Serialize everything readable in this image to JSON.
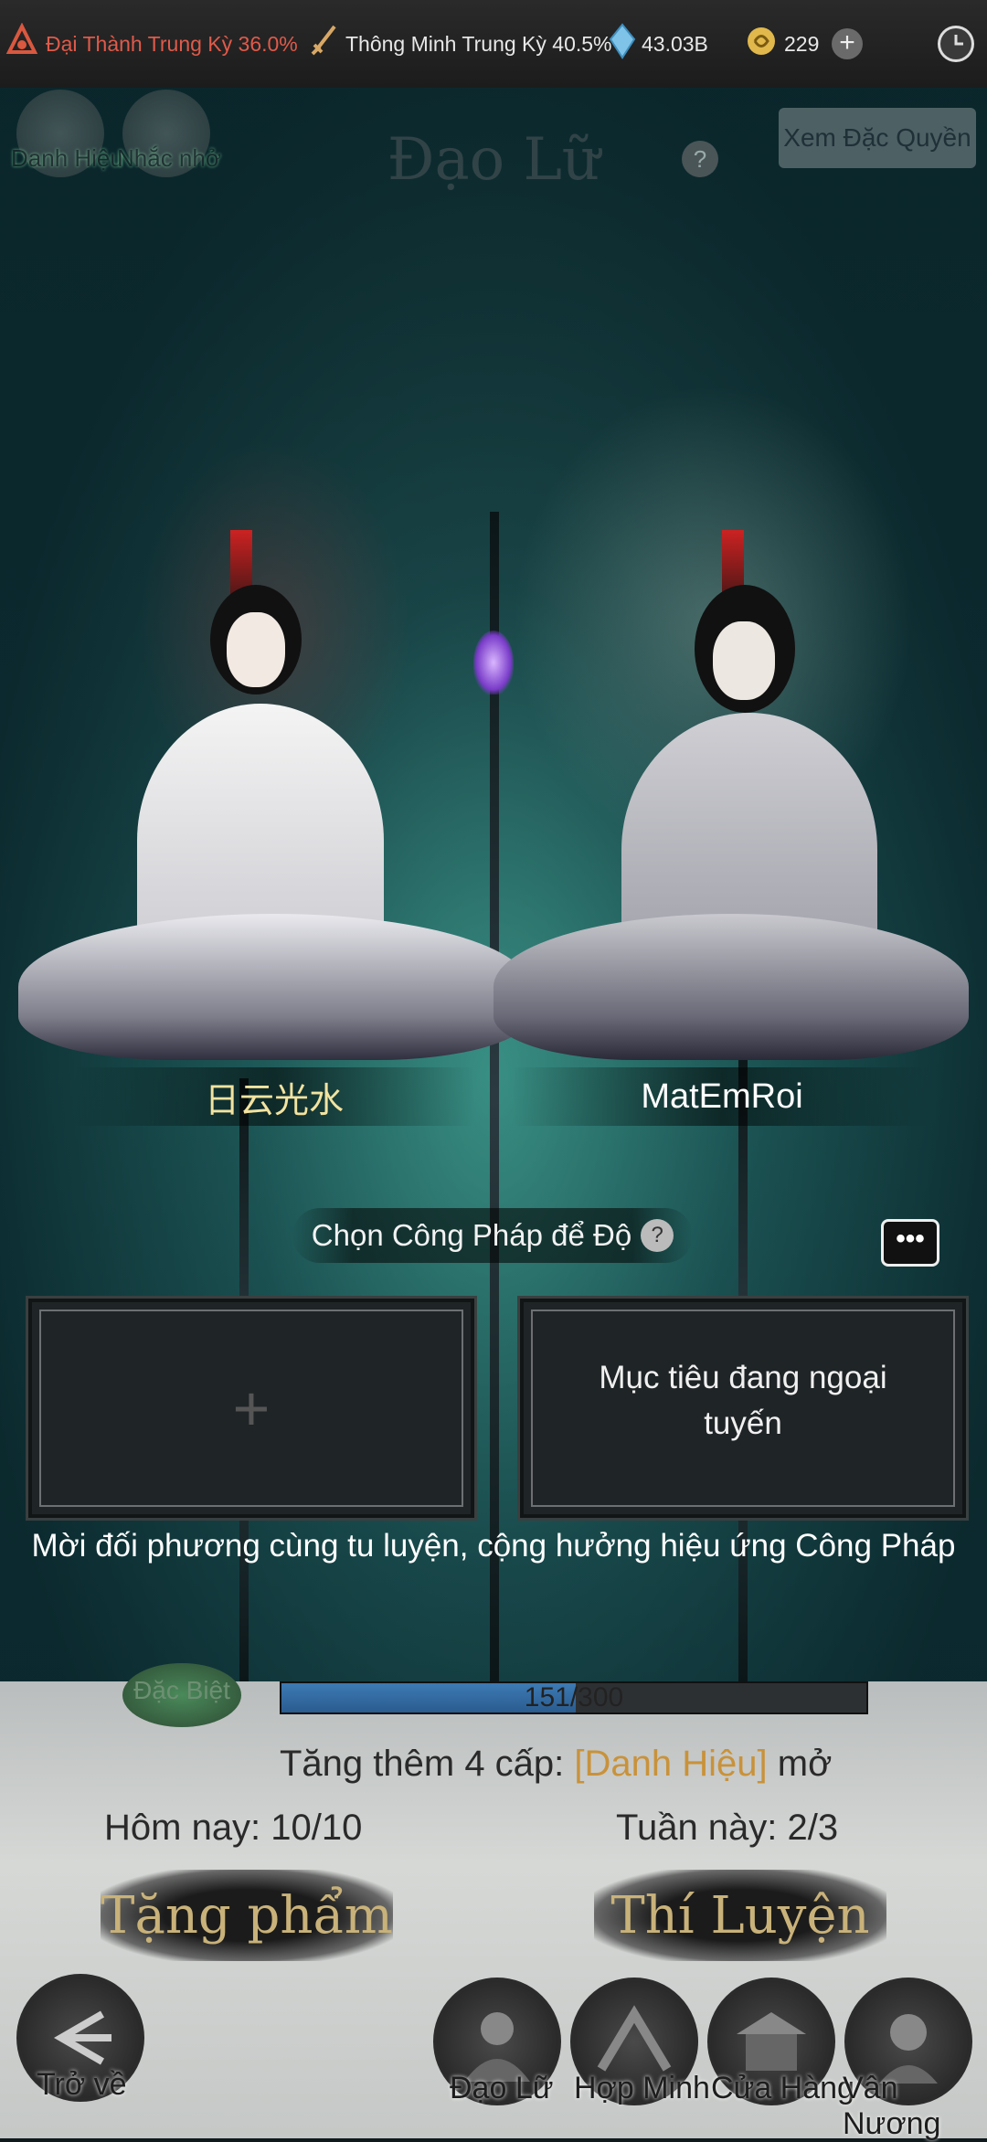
{
  "status_bar": {
    "realm1": "Đại Thành Trung Kỳ 36.0%",
    "realm2": "Thông Minh Trung Kỳ 40.5%",
    "spirit_stones": "43.03B",
    "currency": "229",
    "colors": {
      "realm1": "#e05a4a",
      "realm2": "#ffffff"
    }
  },
  "header": {
    "title": "Đạo Lữ",
    "help": "?",
    "privilege_button": "Xem Đặc Quyền",
    "left_buttons": [
      "Danh Hiệu",
      "Nhắc nhở"
    ]
  },
  "players": {
    "left_name": "日云光水",
    "right_name": "MatEmRoi",
    "colors": {
      "left_name": "#f3e3a0",
      "right_name": "#ffffff"
    }
  },
  "technique": {
    "prompt": "Chọn Công Pháp để Độ",
    "help": "?",
    "chat_icon": "•••",
    "right_slot_message": "Mục tiêu đang ngoại tuyến",
    "invite_text": "Mời đối phương cùng tu luyện, cộng hưởng hiệu ứng Công Pháp"
  },
  "lower_panel": {
    "special_badge": "Đặc Biệt",
    "progress_text": "151/300",
    "progress_fraction": 0.503,
    "level_prefix": "Tăng thêm 4 cấp:",
    "level_highlight": "[Danh Hiệu]",
    "level_suffix": "mở",
    "today": "Hôm nay: 10/10",
    "week": "Tuần này: 2/3",
    "gift_button": "Tặng phẩm",
    "trial_button": "Thí Luyện"
  },
  "bottom_nav": {
    "back": "Trở về",
    "items": [
      "Đạo Lữ",
      "Hợp Minh",
      "Cửa Hàng",
      "Vân Nương"
    ]
  }
}
